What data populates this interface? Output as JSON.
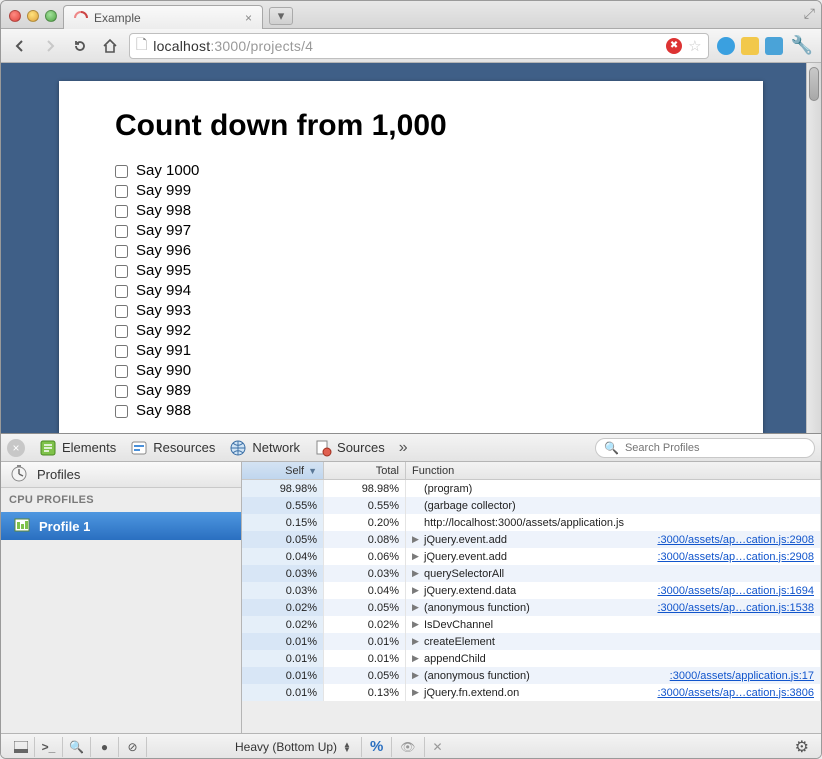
{
  "window": {
    "expand_icon": "⤢"
  },
  "tab": {
    "title": "Example",
    "favicon_color": "#c0392b"
  },
  "toolbar": {
    "url_prefix": "localhost",
    "url_port_path": ":3000/projects/4",
    "search_placeholder": ""
  },
  "page": {
    "heading": "Count down from 1,000",
    "items": [
      "Say 1000",
      "Say 999",
      "Say 998",
      "Say 997",
      "Say 996",
      "Say 995",
      "Say 994",
      "Say 993",
      "Say 992",
      "Say 991",
      "Say 990",
      "Say 989",
      "Say 988"
    ]
  },
  "devtools": {
    "tabs": [
      "Elements",
      "Resources",
      "Network",
      "Sources"
    ],
    "more": "»",
    "search_placeholder": "Search Profiles",
    "sidebar": {
      "title": "Profiles",
      "group": "CPU PROFILES",
      "items": [
        "Profile 1"
      ],
      "selected": 0
    },
    "grid": {
      "columns": {
        "self": "Self",
        "total": "Total",
        "func": "Function"
      },
      "rows": [
        {
          "self": "98.98%",
          "total": "98.98%",
          "expand": false,
          "func": "(program)",
          "src": ""
        },
        {
          "self": "0.55%",
          "total": "0.55%",
          "expand": false,
          "func": "(garbage collector)",
          "src": ""
        },
        {
          "self": "0.15%",
          "total": "0.20%",
          "expand": false,
          "func": "http://localhost:3000/assets/application.js",
          "src": ""
        },
        {
          "self": "0.05%",
          "total": "0.08%",
          "expand": true,
          "func": "jQuery.event.add",
          "src": ":3000/assets/ap…cation.js:2908"
        },
        {
          "self": "0.04%",
          "total": "0.06%",
          "expand": true,
          "func": "jQuery.event.add",
          "src": ":3000/assets/ap…cation.js:2908"
        },
        {
          "self": "0.03%",
          "total": "0.03%",
          "expand": true,
          "func": "querySelectorAll",
          "src": ""
        },
        {
          "self": "0.03%",
          "total": "0.04%",
          "expand": true,
          "func": "jQuery.extend.data",
          "src": ":3000/assets/ap…cation.js:1694"
        },
        {
          "self": "0.02%",
          "total": "0.05%",
          "expand": true,
          "func": "(anonymous function)",
          "src": ":3000/assets/ap…cation.js:1538"
        },
        {
          "self": "0.02%",
          "total": "0.02%",
          "expand": true,
          "func": "IsDevChannel",
          "src": ""
        },
        {
          "self": "0.01%",
          "total": "0.01%",
          "expand": true,
          "func": "createElement",
          "src": ""
        },
        {
          "self": "0.01%",
          "total": "0.01%",
          "expand": true,
          "func": "appendChild",
          "src": ""
        },
        {
          "self": "0.01%",
          "total": "0.05%",
          "expand": true,
          "func": "(anonymous function)",
          "src": ":3000/assets/application.js:17"
        },
        {
          "self": "0.01%",
          "total": "0.13%",
          "expand": true,
          "func": "jQuery.fn.extend.on",
          "src": ":3000/assets/ap…cation.js:3806"
        }
      ]
    },
    "footer": {
      "mode": "Heavy (Bottom Up)",
      "percent": "%"
    }
  }
}
